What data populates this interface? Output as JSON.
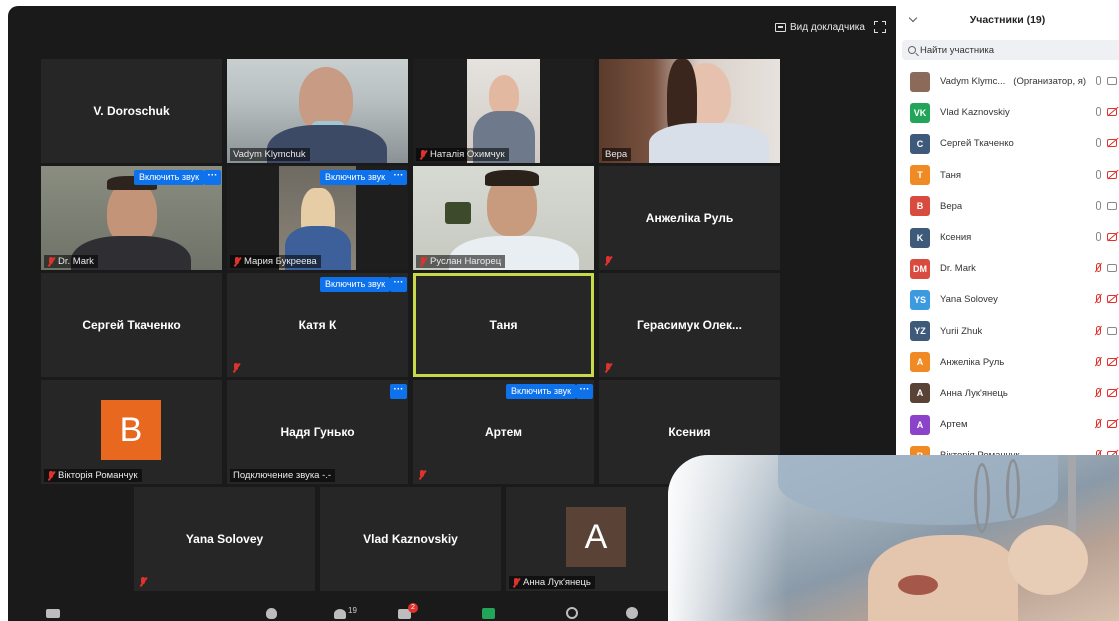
{
  "topbar": {
    "view_label": "Вид докладчика"
  },
  "tiles": [
    {
      "id": "doroschuk",
      "name": "V. Doroschuk",
      "mode": "name"
    },
    {
      "id": "klymchuk",
      "name": "Vadym Klymchuk",
      "mode": "video"
    },
    {
      "id": "okhymchuk",
      "name": "Наталія Охимчук",
      "mode": "video",
      "muted": true
    },
    {
      "id": "vera-video",
      "name": "Вера",
      "mode": "video"
    },
    {
      "id": "mark",
      "name": "Dr. Mark",
      "mode": "video",
      "muted": true,
      "unmute": "Включить звук"
    },
    {
      "id": "bukreeva",
      "name": "Мария Букреева",
      "mode": "video",
      "muted": true,
      "unmute": "Включить звук"
    },
    {
      "id": "nagorec",
      "name": "Руслан Нагорец",
      "mode": "video",
      "muted": true
    },
    {
      "id": "anzhelika",
      "name": "Анжеліка Руль",
      "mode": "name",
      "muted": true
    },
    {
      "id": "tkachenko",
      "name": "Сергей Ткаченко",
      "mode": "name"
    },
    {
      "id": "katya",
      "name": "Катя К",
      "mode": "name",
      "muted": true,
      "unmute": "Включить звук"
    },
    {
      "id": "tanya",
      "name": "Таня",
      "mode": "name",
      "active": true
    },
    {
      "id": "gerasymuk",
      "name": "Герасимук Олек...",
      "mode": "name",
      "muted": true
    },
    {
      "id": "romanchuk",
      "name": "Вікторія Романчук",
      "mode": "avatar",
      "letter": "B",
      "muted": true
    },
    {
      "id": "gunko",
      "name": "Надя Гунько",
      "mode": "name",
      "status": "Подключение звука -.-"
    },
    {
      "id": "artem",
      "name": "Артем",
      "mode": "name",
      "muted": true,
      "unmute": "Включить звук"
    },
    {
      "id": "kseniya",
      "name": "Ксения",
      "mode": "name"
    },
    {
      "id": "solovey",
      "name": "Yana Solovey",
      "mode": "name",
      "muted": true
    },
    {
      "id": "kaznovskiy",
      "name": "Vlad Kaznovskiy",
      "mode": "name"
    },
    {
      "id": "lukianets",
      "name": "Анна Лук'янець",
      "mode": "avatar",
      "letter": "A",
      "muted": true
    }
  ],
  "colors": {
    "active_border": "#c8d94a",
    "unmute_blue": "#0e72ed",
    "muted_red": "#e0322c"
  },
  "toolbar": {
    "participants_count": "19",
    "chat_badge": "2"
  },
  "panel": {
    "title": "Участники (19)",
    "search_placeholder": "Найти участника",
    "participants": [
      {
        "initials": "",
        "name": "Vadym Klymc...",
        "role": "(Организатор, я)",
        "color": "#8c6a5a",
        "mic_muted": false,
        "cam_muted": false
      },
      {
        "initials": "VK",
        "name": "Vlad Kaznovskiy",
        "color": "#23a559",
        "mic_muted": false,
        "cam_muted": true
      },
      {
        "initials": "C",
        "name": "Сергей Ткаченко",
        "color": "#3d5a7a",
        "mic_muted": false,
        "cam_muted": true
      },
      {
        "initials": "T",
        "name": "Таня",
        "color": "#f08a24",
        "mic_muted": false,
        "cam_muted": true
      },
      {
        "initials": "B",
        "name": "Вера",
        "color": "#d94b3f",
        "mic_muted": false,
        "cam_muted": false
      },
      {
        "initials": "K",
        "name": "Ксения",
        "color": "#3d5a7a",
        "mic_muted": false,
        "cam_muted": true
      },
      {
        "initials": "DM",
        "name": "Dr. Mark",
        "color": "#d94b3f",
        "mic_muted": true,
        "cam_muted": false
      },
      {
        "initials": "YS",
        "name": "Yana Solovey",
        "color": "#3c9be0",
        "mic_muted": true,
        "cam_muted": true
      },
      {
        "initials": "YZ",
        "name": "Yurii Zhuk",
        "color": "#3d5a7a",
        "mic_muted": true,
        "cam_muted": false
      },
      {
        "initials": "A",
        "name": "Анжеліка Руль",
        "color": "#f08a24",
        "mic_muted": true,
        "cam_muted": true
      },
      {
        "initials": "A",
        "name": "Анна Лук'янець",
        "color": "#5a4236",
        "mic_muted": true,
        "cam_muted": true
      },
      {
        "initials": "A",
        "name": "Артем",
        "color": "#8a43c9",
        "mic_muted": true,
        "cam_muted": true
      },
      {
        "initials": "B",
        "name": "Вікторія Романчук",
        "color": "#f08a24",
        "mic_muted": true,
        "cam_muted": true
      }
    ]
  }
}
